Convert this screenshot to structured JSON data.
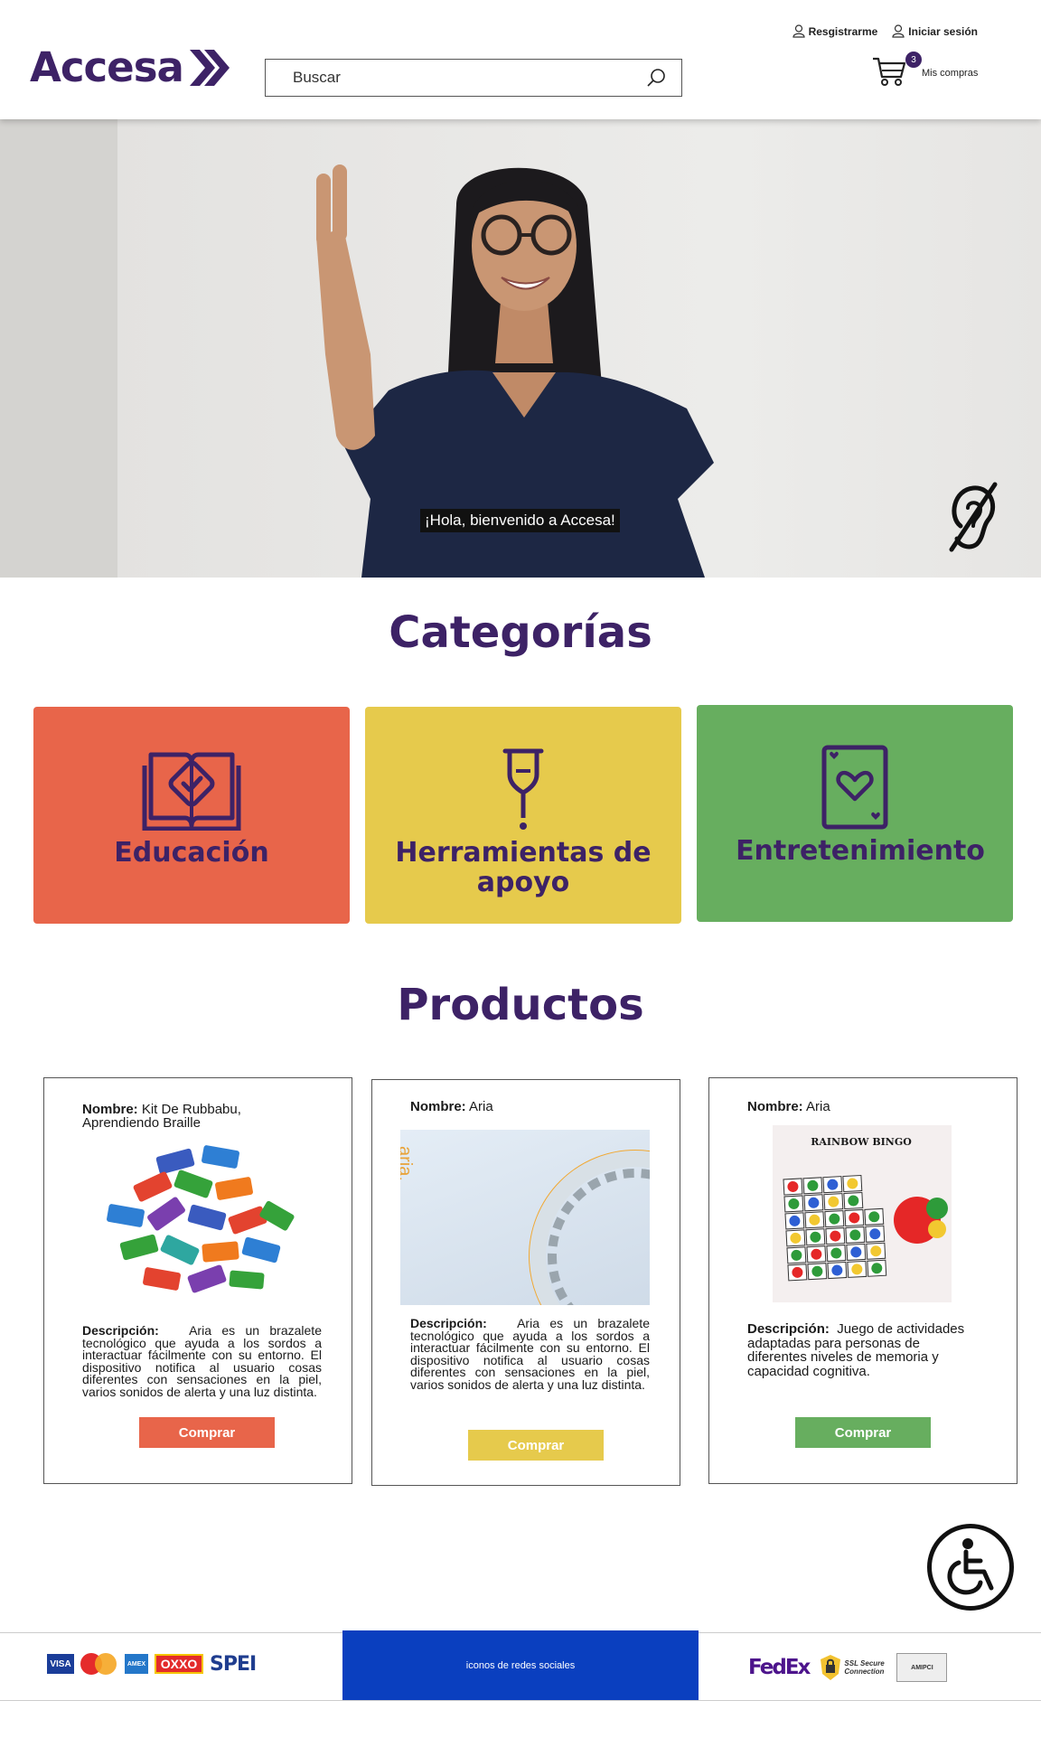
{
  "header": {
    "logo": "Accesa",
    "search_placeholder": "Buscar",
    "register": "Resgistrarme",
    "login": "Iniciar sesión",
    "cart_count": "3",
    "cart_label": "Mis compras"
  },
  "hero": {
    "caption": "¡Hola, bienvenido a Accesa!"
  },
  "categories": {
    "title": "Categorías",
    "items": [
      {
        "label": "Educación",
        "color": "#e8654a"
      },
      {
        "label": "Herramientas de apoyo",
        "color": "#e6ca4c"
      },
      {
        "label": "Entretenimiento",
        "color": "#67ae5f"
      }
    ]
  },
  "products": {
    "title": "Productos",
    "name_label": "Nombre:",
    "desc_label": "Descripción:",
    "buy_label": "Comprar",
    "items": [
      {
        "name": "Kit De Rubbabu, Aprendiendo Braille",
        "description": "Aria es un brazalete tecnológico que ayuda a los sordos a interactuar fácilmente con su entorno. El dispositivo notifica al usuario cosas diferentes con sensaciones en la piel, varios sonidos de alerta y una luz distinta.",
        "button_color": "#e8654a"
      },
      {
        "name": "Aria",
        "image_text": "aria.",
        "description": "Aria es un brazalete tecnológico que ayuda a los sordos a interactuar fácilmente con su entorno. El dispositivo notifica al usuario cosas diferentes con sensaciones en la piel, varios sonidos de alerta y una luz distinta.",
        "button_color": "#e6ca4c"
      },
      {
        "name": "Aria",
        "image_text": "RAINBOW BINGO",
        "description": "Juego de actividades adaptadas para personas de diferentes niveles de memoria y capacidad cognitiva.",
        "button_color": "#67ae5f"
      }
    ]
  },
  "footer": {
    "social_placeholder": "iconos de redes sociales",
    "payments": [
      "VISA",
      "MasterCard",
      "AMEX",
      "OXXO",
      "SPEI"
    ],
    "trust": [
      "FedEx",
      "SSL Secure Connection",
      "AMIPCI"
    ]
  },
  "colors": {
    "brand": "#3d2266",
    "social_bar": "#0a3fbf"
  }
}
